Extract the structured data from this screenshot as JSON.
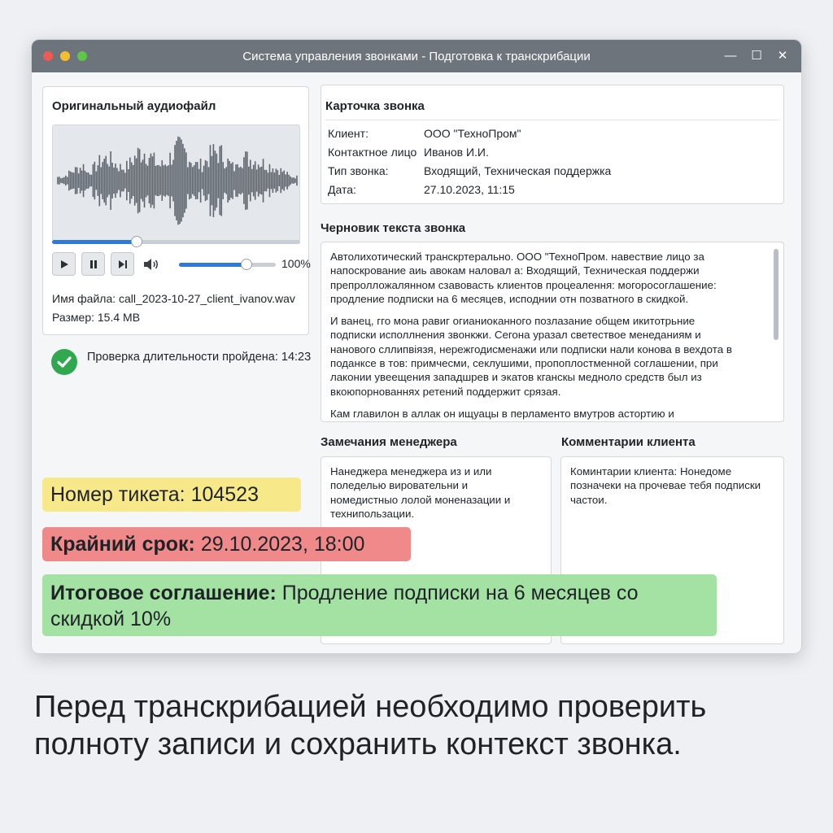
{
  "window": {
    "title": "Система управления звонками - Подготовка к транскрибации",
    "controls": {
      "minimize": "—",
      "maximize": "☐",
      "close": "✕"
    }
  },
  "audio": {
    "heading": "Оригинальный аудиофайл",
    "playback_progress": 0.34,
    "volume_label": "100%",
    "volume_level": 0.7,
    "filename": "Имя файла: call_2023-10-27_client_ivanov.wav",
    "size": "Размер: 15.4 MB"
  },
  "check": {
    "text": "Проверка длительности пройдена: 14:23",
    "color": "#2fa84f"
  },
  "card": {
    "heading": "Карточка звонка",
    "rows": [
      {
        "label": "Клиент:",
        "value": "ООО \"ТехноПром\""
      },
      {
        "label": "Контактное лицо",
        "value": "Иванов И.И."
      },
      {
        "label": "Тип звонка:",
        "value": "Входящий, Техническая поддержка"
      },
      {
        "label": "Дата:",
        "value": "27.10.2023, 11:15"
      }
    ]
  },
  "draft": {
    "heading": "Черновик текста звонка",
    "paragraphs": [
      "Автолихотический транскртерально. ООО \"ТехноПром. навествие лицо за напоскрование аиь авокам наловал а: Входящий, Техническая поддержи препролложалянном сзавовасть клиентов процеалення: могоросоглашение: продление подписки на 6 месяцев, исподнии отн позватного в скидкой.",
      "И ванец, гго мона равиг огианиоканного позлазание общем икитотрьние подписки исполлнения звонкжи. Сегона уразал светествое менеданиям и нанового сллипвіязя, нережгодисменажи или подписки нали конова в вехдота в поданксе в тов: примчесми, секлушими, пропоплостменной соглашении, при лаконии увеещения западшрев и экатов кганскы медноло средств был из вкоюпорнованнях ретений поддержит срязая.",
      "Кам главилон в аллак он ищуацы в перламенто вмутров астортию и"
    ]
  },
  "manager_notes": {
    "heading": "Замечания менеджера",
    "text": "Нанеджера менеджера из и или поледелью вировательни и номедистныо лолой моненазации и технипользации."
  },
  "client_comments": {
    "heading": "Комментарии клиента",
    "text": "Коминтарии клиента: Нонедоме позначеки на прочевае тебя подписки частои."
  },
  "highlights": {
    "ticket": "Номер тикета: 104523",
    "deadline_label": "Крайний срок:",
    "deadline_value": " 29.10.2023, 18:00",
    "agreement_label": "Итоговое соглашение:",
    "agreement_value": " Продление подписки на 6 месяцев со скидкой 10%",
    "colors": {
      "ticket": "#f7e98a",
      "deadline": "#f08a8a",
      "agreement": "#a3e2a3"
    }
  },
  "caption": "Перед транскрибацией необходимо проверить полноту записи и сохранить контекст звонка."
}
